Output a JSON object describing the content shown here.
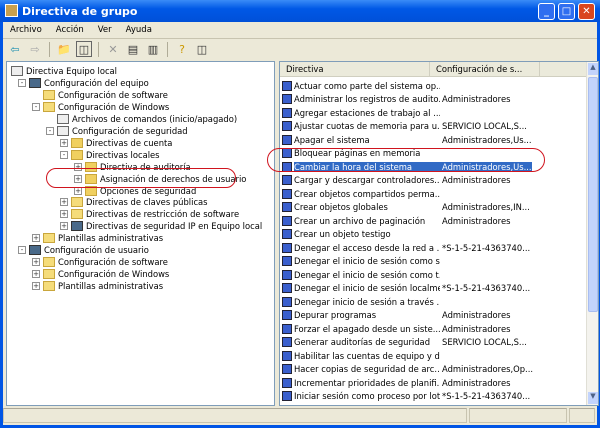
{
  "window": {
    "title": "Directiva de grupo",
    "minimize": "_",
    "maximize": "□",
    "close": "✕"
  },
  "menu": [
    "Archivo",
    "Acción",
    "Ver",
    "Ayuda"
  ],
  "toolbar": [
    "back-arrow",
    "forward-arrow",
    "up-folder",
    "show-tree",
    "delete",
    "properties",
    "export",
    "help",
    "console-tree"
  ],
  "tree": [
    {
      "label": "Directiva Equipo local",
      "level": 0,
      "icon": "policy",
      "exp": ""
    },
    {
      "label": "Configuración del equipo",
      "level": 1,
      "icon": "pc",
      "exp": "-"
    },
    {
      "label": "Configuración de software",
      "level": 2,
      "icon": "folder",
      "exp": ""
    },
    {
      "label": "Configuración de Windows",
      "level": 2,
      "icon": "folder",
      "exp": "-"
    },
    {
      "label": "Archivos de comandos (inicio/apagado)",
      "level": 3,
      "icon": "doc",
      "exp": ""
    },
    {
      "label": "Configuración de seguridad",
      "level": 3,
      "icon": "doc",
      "exp": "-"
    },
    {
      "label": "Directivas de cuenta",
      "level": 4,
      "icon": "lock",
      "exp": "+"
    },
    {
      "label": "Directivas locales",
      "level": 4,
      "icon": "lock",
      "exp": "-"
    },
    {
      "label": "Directiva de auditoría",
      "level": 5,
      "icon": "lock",
      "exp": "+"
    },
    {
      "label": "Asignación de derechos de usuario",
      "level": 5,
      "icon": "lock",
      "exp": "+"
    },
    {
      "label": "Opciones de seguridad",
      "level": 5,
      "icon": "lock",
      "exp": "+"
    },
    {
      "label": "Directivas de claves públicas",
      "level": 4,
      "icon": "folder",
      "exp": "+"
    },
    {
      "label": "Directivas de restricción de software",
      "level": 4,
      "icon": "folder",
      "exp": "+"
    },
    {
      "label": "Directivas de seguridad IP en Equipo local",
      "level": 4,
      "icon": "pc",
      "exp": "+"
    },
    {
      "label": "Plantillas administrativas",
      "level": 2,
      "icon": "folder",
      "exp": "+"
    },
    {
      "label": "Configuración de usuario",
      "level": 1,
      "icon": "pc",
      "exp": "-"
    },
    {
      "label": "Configuración de software",
      "level": 2,
      "icon": "folder",
      "exp": "+"
    },
    {
      "label": "Configuración de Windows",
      "level": 2,
      "icon": "folder",
      "exp": "+"
    },
    {
      "label": "Plantillas administrativas",
      "level": 2,
      "icon": "folder",
      "exp": "+"
    }
  ],
  "list": {
    "columns": [
      "Directiva",
      "Configuración de s..."
    ],
    "selected": "Cambiar la hora del sistema",
    "rows": [
      [
        "Actuar como parte del sistema op...",
        ""
      ],
      [
        "Administrar los registros de audito...",
        "Administradores"
      ],
      [
        "Agregar estaciones de trabajo al ...",
        ""
      ],
      [
        "Ajustar cuotas de memoria para u...",
        "SERVICIO LOCAL,S..."
      ],
      [
        "Apagar el sistema",
        "Administradores,Us..."
      ],
      [
        "Bloquear páginas en memoria",
        ""
      ],
      [
        "Cambiar la hora del sistema",
        "Administradores,Us..."
      ],
      [
        "Cargar y descargar controladores...",
        "Administradores"
      ],
      [
        "Crear objetos compartidos perma...",
        ""
      ],
      [
        "Crear objetos globales",
        "Administradores,IN..."
      ],
      [
        "Crear un archivo de paginación",
        "Administradores"
      ],
      [
        "Crear un objeto testigo",
        ""
      ],
      [
        "Denegar el acceso desde la red a ...",
        "*S-1-5-21-4363740..."
      ],
      [
        "Denegar el inicio de sesión como s...",
        ""
      ],
      [
        "Denegar el inicio de sesión como t...",
        ""
      ],
      [
        "Denegar el inicio de sesión localme...",
        "*S-1-5-21-4363740..."
      ],
      [
        "Denegar inicio de sesión a través ...",
        ""
      ],
      [
        "Depurar programas",
        "Administradores"
      ],
      [
        "Forzar el apagado desde un siste...",
        "Administradores"
      ],
      [
        "Generar auditorías de seguridad",
        "SERVICIO LOCAL,S..."
      ],
      [
        "Habilitar las cuentas de equipo y d...",
        ""
      ],
      [
        "Hacer copias de seguridad de arc...",
        "Administradores,Op..."
      ],
      [
        "Incrementar prioridades de planifi...",
        "Administradores"
      ],
      [
        "Iniciar sesión como proceso por lotes",
        "*S-1-5-21-4363740..."
      ],
      [
        "Iniciar sesión como servicio",
        "Servicio de red"
      ],
      [
        "Inicio de sesión local",
        "support2,Administr..."
      ]
    ]
  },
  "colors": {
    "titlebar": "#0058e6",
    "selection": "#316ac5",
    "highlight_ellipse": "#d0141e"
  }
}
